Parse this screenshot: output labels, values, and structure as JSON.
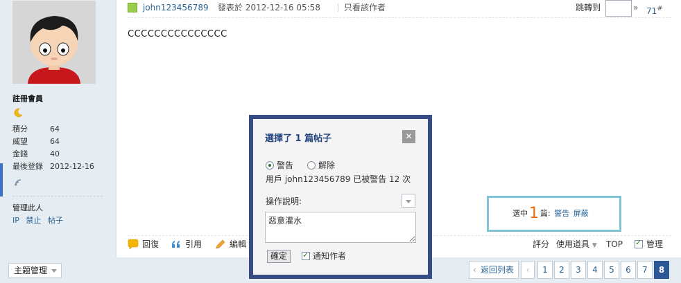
{
  "user": {
    "role": "註冊會員",
    "stats": [
      {
        "label": "積分",
        "value": "64"
      },
      {
        "label": "威望",
        "value": "64"
      },
      {
        "label": "金錢",
        "value": "40"
      },
      {
        "label": "最後登錄",
        "value": "2012-12-16"
      }
    ],
    "manage_title": "管理此人",
    "manage_links": [
      "IP",
      "禁止",
      "帖子"
    ]
  },
  "post": {
    "author": "john123456789",
    "meta": "發表於 2012-12-16 05:58",
    "only_author": "只看該作者",
    "jump_label": "跳轉到",
    "jump_go": "»",
    "floor": "71",
    "floor_suffix": "#",
    "content": "CCCCCCCCCCCCCCC"
  },
  "mod_box": {
    "selected_prefix": "選中",
    "selected_count": "1",
    "selected_suffix": "篇:",
    "warn_link": "警告",
    "block_link": "屏蔽"
  },
  "actions": {
    "reply": "回復",
    "quote": "引用",
    "edit": "編輯",
    "rate": "評分",
    "use_tool": "使用道具",
    "top": "TOP",
    "manage": "管理"
  },
  "footer": {
    "thread_manage": "主題管理",
    "back_list": "返回列表",
    "pages": [
      "1",
      "2",
      "3",
      "4",
      "5",
      "6",
      "7",
      "8"
    ],
    "current_page": "8"
  },
  "modal": {
    "title": "選擇了 1 篇帖子",
    "close": "✕",
    "radio_warn": "警告",
    "radio_remove": "解除",
    "warn_text": "用戶 john123456789 已被警告 12 次",
    "reason_label": "操作說明:",
    "reason_value": "惡意灌水",
    "confirm": "確定",
    "notify": "通知作者"
  },
  "colors": {
    "modal_border": "#354d84",
    "mod_box_border": "#7fc5d4",
    "count_orange": "#f06a0a",
    "link_blue": "#2a6496",
    "current_page_bg": "#2b5796"
  }
}
